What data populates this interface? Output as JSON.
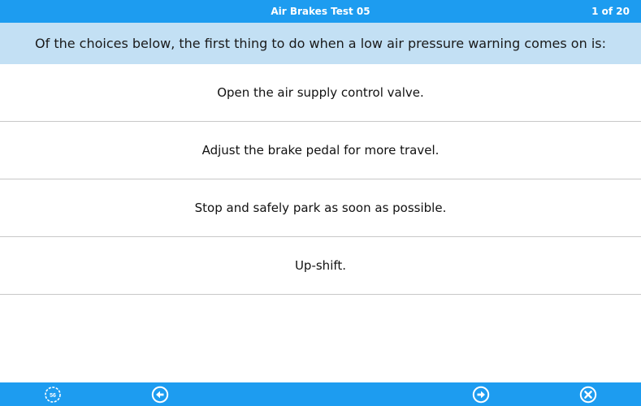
{
  "header": {
    "title": "Air Brakes Test 05",
    "counter": "1 of 20"
  },
  "question": {
    "text": "Of the choices below, the first thing to do when a low air pressure warning comes on is:"
  },
  "answers": [
    {
      "label": "Open the air supply control valve."
    },
    {
      "label": "Adjust the brake pedal for more travel."
    },
    {
      "label": "Stop and safely park as soon as possible."
    },
    {
      "label": "Up-shift."
    }
  ],
  "toolbar": {
    "timer_value": "56",
    "icons": [
      "timer-icon",
      "previous-arrow-icon",
      "next-arrow-icon",
      "close-icon"
    ]
  },
  "colors": {
    "bar": "#1d9cf0",
    "question_bg": "#c3e0f4",
    "divider": "#c8c8c8"
  }
}
